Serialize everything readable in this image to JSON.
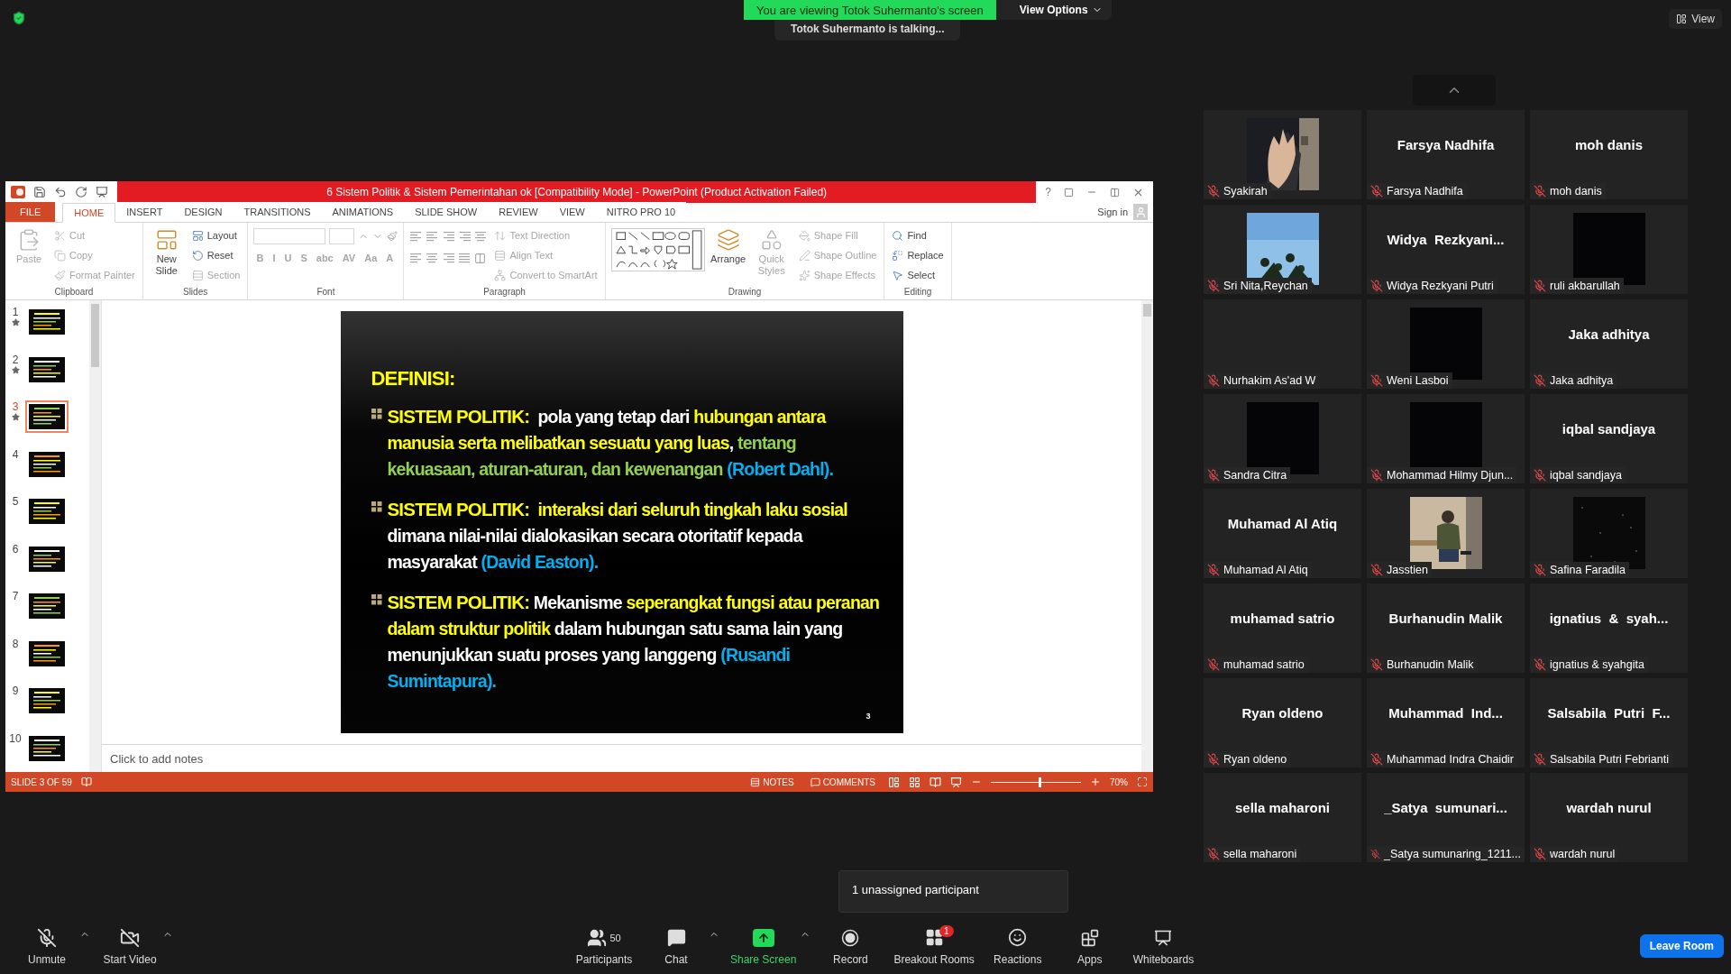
{
  "top_bar": {
    "banner": "You are viewing Totok Suhermanto's screen",
    "view_options": "View Options",
    "speaker": "Totok Suhermanto is talking...",
    "view": "View"
  },
  "powerpoint": {
    "title": "6 Sistem Politik & Sistem Pemerintahan ok [Compatibility Mode] -  PowerPoint (Product Activation Failed)",
    "help": "?",
    "tabs": [
      {
        "label": "FILE",
        "kind": "file",
        "selected": false
      },
      {
        "label": "HOME",
        "kind": "tab",
        "selected": true
      },
      {
        "label": "INSERT",
        "kind": "tab",
        "selected": false
      },
      {
        "label": "DESIGN",
        "kind": "tab",
        "selected": false
      },
      {
        "label": "TRANSITIONS",
        "kind": "tab",
        "selected": false
      },
      {
        "label": "ANIMATIONS",
        "kind": "tab",
        "selected": false
      },
      {
        "label": "SLIDE SHOW",
        "kind": "tab",
        "selected": false
      },
      {
        "label": "REVIEW",
        "kind": "tab",
        "selected": false
      },
      {
        "label": "VIEW",
        "kind": "tab",
        "selected": false
      },
      {
        "label": "NITRO PRO 10",
        "kind": "tab",
        "selected": false
      }
    ],
    "sign_in": "Sign in",
    "ribbon": [
      {
        "label": "Clipboard",
        "kind": "clipboard",
        "commands": [
          {
            "label": "Paste",
            "kind": "large",
            "disabled": true
          },
          {
            "label": "Cut",
            "kind": "small",
            "disabled": true
          },
          {
            "label": "Copy",
            "kind": "small",
            "disabled": true
          },
          {
            "label": "Format Painter",
            "kind": "small",
            "disabled": true
          }
        ]
      },
      {
        "label": "Slides",
        "kind": "slides",
        "commands": [
          {
            "label": "New Slide",
            "kind": "large",
            "disabled": false
          },
          {
            "label": "Layout",
            "kind": "small",
            "disabled": false
          },
          {
            "label": "Reset",
            "kind": "small",
            "disabled": false
          },
          {
            "label": "Section",
            "kind": "small",
            "disabled": true
          }
        ]
      },
      {
        "label": "Font",
        "kind": "font",
        "commands": [
          {
            "label": "B",
            "kind": "glyph",
            "disabled": true
          },
          {
            "label": "I",
            "kind": "glyph",
            "disabled": true
          },
          {
            "label": "U",
            "kind": "glyph",
            "disabled": true
          },
          {
            "label": "S",
            "kind": "glyph",
            "disabled": true
          },
          {
            "label": "abc",
            "kind": "glyph",
            "disabled": true
          },
          {
            "label": "AV",
            "kind": "glyph",
            "disabled": true
          },
          {
            "label": "Aa",
            "kind": "glyph",
            "disabled": true
          },
          {
            "label": "A",
            "kind": "glyph",
            "disabled": true
          }
        ]
      },
      {
        "label": "Paragraph",
        "kind": "paragraph",
        "commands": [
          {
            "label": "Text Direction",
            "kind": "small",
            "disabled": true
          },
          {
            "label": "Align Text",
            "kind": "small",
            "disabled": true
          },
          {
            "label": "Convert to SmartArt",
            "kind": "small",
            "disabled": true
          }
        ]
      },
      {
        "label": "Drawing",
        "kind": "drawing",
        "commands": [
          {
            "label": "Arrange",
            "kind": "large",
            "disabled": false
          },
          {
            "label": "Quick Styles",
            "kind": "large",
            "disabled": true
          },
          {
            "label": "Shape Fill",
            "kind": "small",
            "disabled": true
          },
          {
            "label": "Shape Outline",
            "kind": "small",
            "disabled": true
          },
          {
            "label": "Shape Effects",
            "kind": "small",
            "disabled": true
          }
        ]
      },
      {
        "label": "Editing",
        "kind": "editing",
        "commands": [
          {
            "label": "Find",
            "kind": "small",
            "disabled": false
          },
          {
            "label": "Replace",
            "kind": "small",
            "disabled": false
          },
          {
            "label": "Select",
            "kind": "small",
            "disabled": false
          }
        ]
      }
    ],
    "thumbnails": [
      {
        "number": "1",
        "animated": true,
        "selected": false
      },
      {
        "number": "2",
        "animated": true,
        "selected": false
      },
      {
        "number": "3",
        "animated": true,
        "selected": true
      },
      {
        "number": "4",
        "animated": false,
        "selected": false
      },
      {
        "number": "5",
        "animated": false,
        "selected": false
      },
      {
        "number": "6",
        "animated": false,
        "selected": false
      },
      {
        "number": "7",
        "animated": false,
        "selected": false
      },
      {
        "number": "8",
        "animated": false,
        "selected": false
      },
      {
        "number": "9",
        "animated": false,
        "selected": false
      },
      {
        "number": "10",
        "animated": false,
        "selected": false
      }
    ],
    "slide": {
      "heading": "DEFINISI:",
      "page_number": "3",
      "bullets": [
        {
          "segments": [
            {
              "text": "SISTEM POLITIK:",
              "kind": "label",
              "color": "#ffff00"
            },
            {
              "text": "  pola yang tetap dari ",
              "kind": "text",
              "color": "#ffffff"
            },
            {
              "text": "hubungan antara manusia serta melibatkan sesuatu yang luas",
              "kind": "text",
              "color": "#ffff00"
            },
            {
              "text": ", ",
              "kind": "text",
              "color": "#ffffff"
            },
            {
              "text": "tentang kekuasaan, aturan-aturan, dan kewenangan ",
              "kind": "text",
              "color": "#92d050"
            },
            {
              "text": "(Robert Dahl).",
              "kind": "text",
              "color": "#00b0f0"
            }
          ]
        },
        {
          "segments": [
            {
              "text": "SISTEM POLITIK:",
              "kind": "label",
              "color": "#ffff00"
            },
            {
              "text": "  interaksi dari seluruh tingkah laku sosial ",
              "kind": "text",
              "color": "#ffff00"
            },
            {
              "text": "dimana nilai-nilai dialokasikan secara otoritatif kepada masyarakat ",
              "kind": "text",
              "color": "#ffffff"
            },
            {
              "text": "(David Easton).",
              "kind": "text",
              "color": "#00b0f0"
            }
          ]
        },
        {
          "segments": [
            {
              "text": "SISTEM POLITIK:",
              "kind": "label",
              "color": "#ffff00"
            },
            {
              "text": " Mekanisme ",
              "kind": "text",
              "color": "#ffffff"
            },
            {
              "text": "seperangkat fungsi atau peranan dalam struktur politik ",
              "kind": "text",
              "color": "#ffff00"
            },
            {
              "text": "dalam hubungan satu sama lain yang menunjukkan suatu proses yang langgeng ",
              "kind": "text",
              "color": "#ffffff"
            },
            {
              "text": "(Rusandi Sumintapura).",
              "kind": "text",
              "color": "#00b0f0"
            }
          ]
        }
      ]
    },
    "notes_placeholder": "Click to add notes",
    "status_bar": {
      "slide_indicator": "SLIDE 3 OF 59",
      "notes": "NOTES",
      "comments": "COMMENTS",
      "zoom": {
        "label": "70%",
        "level": 0.53
      }
    }
  },
  "participants": [
    {
      "name": "Syakirah",
      "kind": "picture",
      "muted": true
    },
    {
      "name": "Farsya Nadhifa",
      "kind": "name",
      "display": "Farsya Nadhifa",
      "muted": true
    },
    {
      "name": "moh danis",
      "kind": "name",
      "display": "moh danis",
      "muted": true
    },
    {
      "name": "Sri Nita,Reychan",
      "kind": "picture",
      "muted": true
    },
    {
      "name": "Widya Rezkyani Putri",
      "kind": "name",
      "display": "Widya  Rezkyani...",
      "muted": true
    },
    {
      "name": "ruli akbarullah",
      "kind": "dark",
      "muted": true
    },
    {
      "name": "Nurhakim As'ad W",
      "kind": "blank",
      "muted": true
    },
    {
      "name": "Weni Lasboi",
      "kind": "dark",
      "muted": true
    },
    {
      "name": "Jaka adhitya",
      "kind": "name",
      "display": "Jaka adhitya",
      "muted": true
    },
    {
      "name": "Sandra Citra",
      "kind": "dark",
      "muted": true
    },
    {
      "name": "Mohammad Hilmy Djun...",
      "kind": "dark",
      "muted": true
    },
    {
      "name": "iqbal sandjaya",
      "kind": "name",
      "display": "iqbal sandjaya",
      "muted": true
    },
    {
      "name": "Muhamad Al Atiq",
      "kind": "name",
      "display": "Muhamad Al Atiq",
      "muted": true
    },
    {
      "name": "Jasstien",
      "kind": "picture",
      "muted": true
    },
    {
      "name": "Safina Faradila",
      "kind": "picture",
      "muted": true
    },
    {
      "name": "muhamad satrio",
      "kind": "name",
      "display": "muhamad satrio",
      "muted": true
    },
    {
      "name": "Burhanudin Malik",
      "kind": "name",
      "display": "Burhanudin Malik",
      "muted": true
    },
    {
      "name": "ignatius & syahgita",
      "kind": "name",
      "display": "ignatius  &  syah...",
      "muted": true
    },
    {
      "name": "Ryan oldeno",
      "kind": "name",
      "display": "Ryan oldeno",
      "muted": true
    },
    {
      "name": "Muhammad Indra Chaidir",
      "kind": "name",
      "display": "Muhammad  Ind...",
      "muted": true
    },
    {
      "name": "Salsabila Putri Febrianti",
      "kind": "name",
      "display": "Salsabila  Putri  F...",
      "muted": true
    },
    {
      "name": "sella maharoni",
      "kind": "name",
      "display": "sella maharoni",
      "muted": true
    },
    {
      "name": "_Satya sumunaring_1211...",
      "kind": "name",
      "display": "_Satya  sumunari...",
      "muted": true
    },
    {
      "name": "wardah nurul",
      "kind": "name",
      "display": "wardah nurul",
      "muted": true
    }
  ],
  "tooltip": "1 unassigned participant",
  "toolbar": {
    "left": [
      {
        "label": "Unmute",
        "kind": "mic",
        "caret": true
      },
      {
        "label": "Start Video",
        "kind": "video",
        "caret": true
      }
    ],
    "center": [
      {
        "label": "Participants",
        "kind": "participants",
        "count": "50"
      },
      {
        "label": "Chat",
        "kind": "chat",
        "caret": true
      },
      {
        "label": "Share Screen",
        "kind": "share",
        "caret": true
      },
      {
        "label": "Record",
        "kind": "record"
      },
      {
        "label": "Breakout Rooms",
        "kind": "breakout",
        "badge": "1"
      },
      {
        "label": "Reactions",
        "kind": "reactions"
      },
      {
        "label": "Apps",
        "kind": "apps"
      },
      {
        "label": "Whiteboards",
        "kind": "whiteboards"
      }
    ],
    "leave": "Leave Room"
  }
}
